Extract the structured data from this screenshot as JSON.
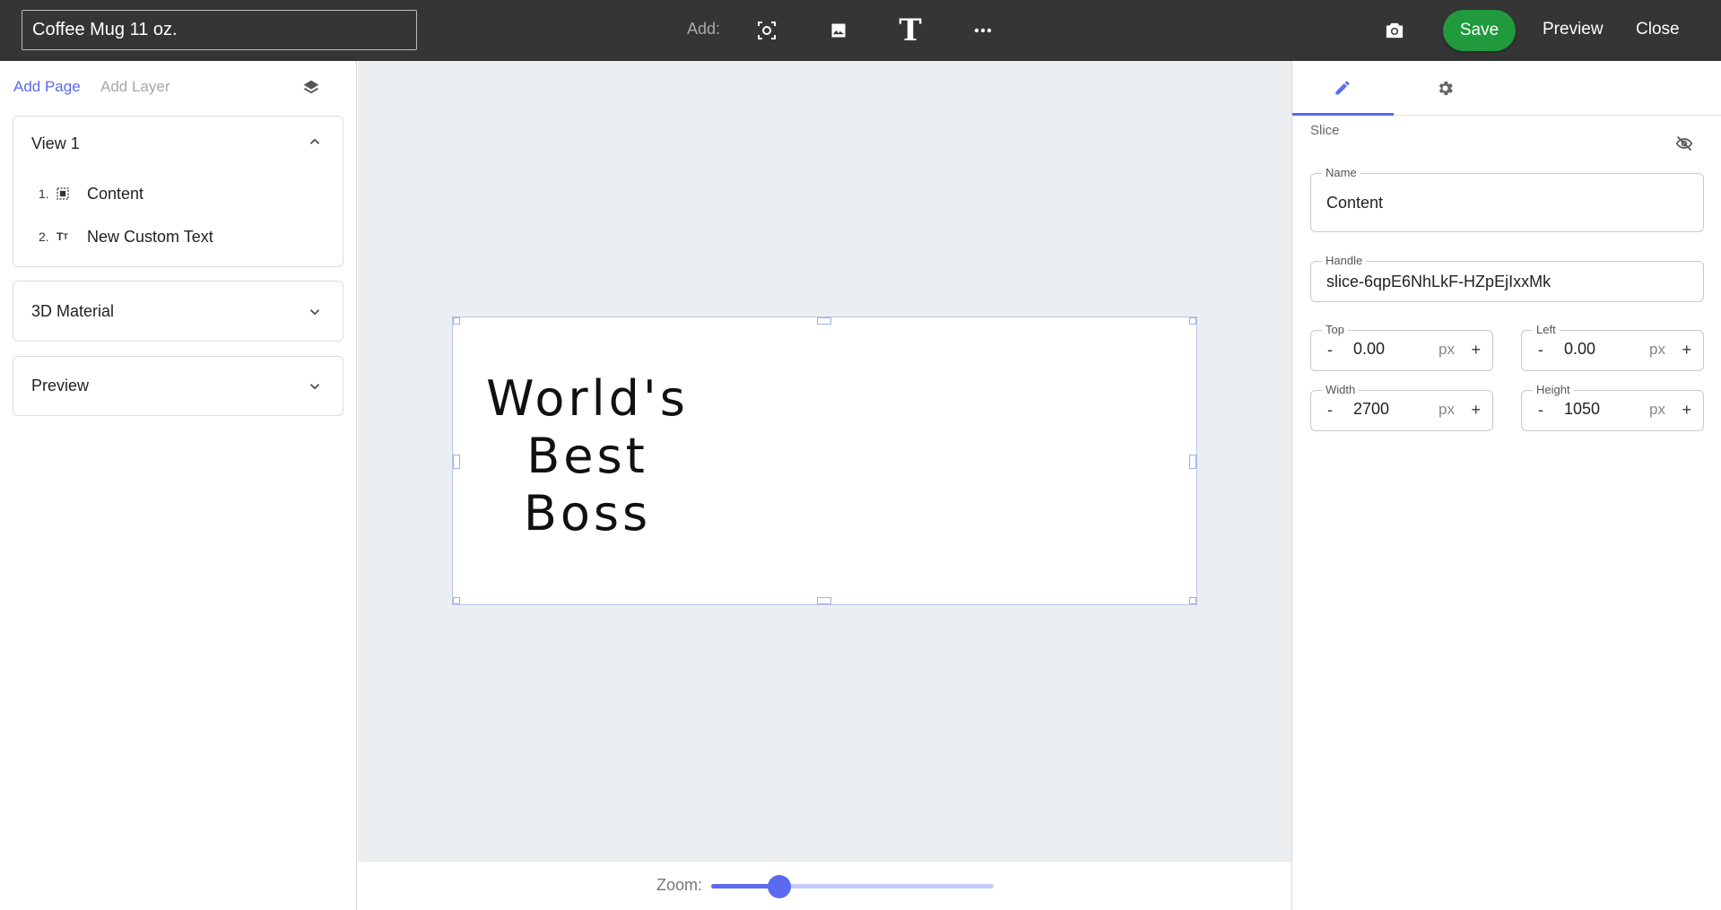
{
  "topbar": {
    "title_value": "Coffee Mug 11 oz.",
    "add_label": "Add:",
    "tools": [
      "slice-icon",
      "image-icon",
      "text-icon",
      "more-icon"
    ],
    "camera_icon": "camera-icon",
    "save_label": "Save",
    "preview_label": "Preview",
    "close_label": "Close",
    "save_color": "#1f9a3d"
  },
  "left_panel": {
    "add_page_label": "Add Page",
    "add_layer_label": "Add Layer",
    "layers_icon": "layers-icon",
    "views": [
      {
        "title": "View 1",
        "expanded": true,
        "layers": [
          {
            "number": "1.",
            "icon": "slice-icon",
            "label": "Content"
          },
          {
            "number": "2.",
            "icon": "text-size-icon",
            "label": "New Custom Text"
          }
        ]
      },
      {
        "title": "3D Material",
        "expanded": false
      },
      {
        "title": "Preview",
        "expanded": false
      }
    ]
  },
  "canvas": {
    "text_lines": [
      "World's",
      "Best",
      "Boss"
    ]
  },
  "zoom": {
    "label": "Zoom:",
    "level": 0.24
  },
  "right_panel": {
    "tabs": [
      "edit-icon",
      "settings-icon"
    ],
    "active_tab": 0,
    "section_label": "Slice",
    "visibility_icon": "eye-off-icon",
    "name": {
      "label": "Name",
      "value": "Content"
    },
    "handle": {
      "label": "Handle",
      "value": "slice-6qpE6NhLkF-HZpEjIxxMk"
    },
    "top": {
      "label": "Top",
      "value": "0.00",
      "unit": "px"
    },
    "left": {
      "label": "Left",
      "value": "0.00",
      "unit": "px"
    },
    "width": {
      "label": "Width",
      "value": "2700",
      "unit": "px"
    },
    "height": {
      "label": "Height",
      "value": "1050",
      "unit": "px"
    },
    "minus": "-",
    "plus": "+"
  },
  "colors": {
    "accent": "#5b6af0",
    "topbar_bg": "#353535",
    "canvas_bg": "#eceff2"
  }
}
